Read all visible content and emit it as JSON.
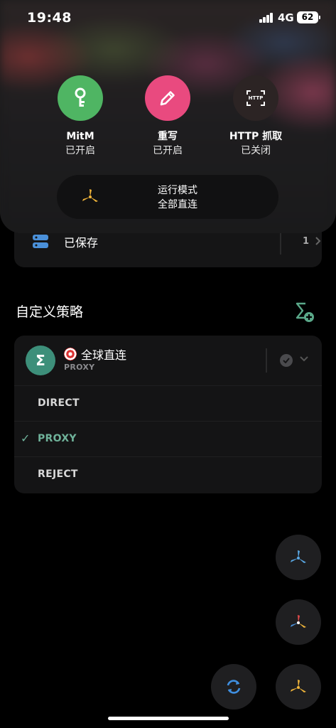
{
  "status_bar": {
    "time": "19:48",
    "network": "4G",
    "battery": "62"
  },
  "toggles": [
    {
      "title": "MitM",
      "state": "已开启",
      "color": "#4fb563",
      "icon": "key-icon"
    },
    {
      "title": "重写",
      "state": "已开启",
      "color": "#e94a7f",
      "icon": "pencil-icon"
    },
    {
      "title": "HTTP 抓取",
      "state": "已关闭",
      "color": "#2c2424",
      "icon": "http-capture-icon",
      "icon_text": "HTTP"
    }
  ],
  "run_mode": {
    "label": "运行模式",
    "value": "全部直连",
    "icon": "direct-mode-icon"
  },
  "saved": {
    "label": "已保存",
    "count": "1"
  },
  "custom_policy": {
    "section_title": "自定义策略",
    "group": {
      "avatar": "Σ",
      "name": "全球直连",
      "emoji_icon": "target-dart-icon",
      "current": "PROXY",
      "options": [
        "DIRECT",
        "PROXY",
        "REJECT"
      ],
      "selected": "PROXY",
      "check_mark": "✓"
    }
  },
  "colors": {
    "accent_green": "#6fb29a",
    "avatar_bg": "#3d8f7a",
    "fab_bg": "#1f1f21"
  }
}
